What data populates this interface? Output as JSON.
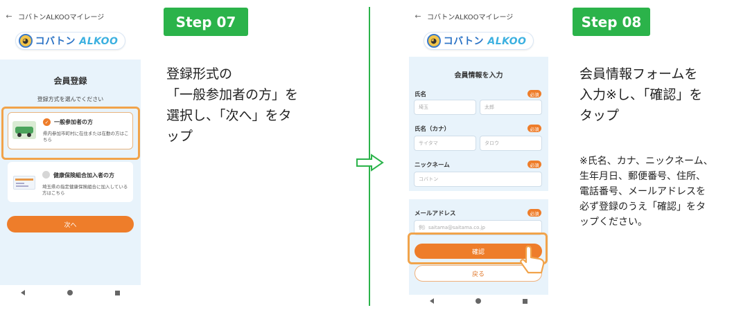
{
  "left_phone": {
    "back_icon": "←",
    "app_title": "コバトンALKOOマイレージ",
    "logo_text": "コバトン",
    "logo_text_en": "ALKOO",
    "page_title": "会員登録",
    "subtitle": "登録方式を選んでください",
    "option1": {
      "label": "一般参加者の方",
      "desc": "県内参加市町村に在住または在勤の方はこちら"
    },
    "option2": {
      "label": "健康保険組合加入者の方",
      "desc": "埼玉県の指定健康保険組合に加入している方はこちら"
    },
    "next_button": "次へ"
  },
  "step07": {
    "badge": "Step 07",
    "text": "登録形式の\n「一般参加者の方」を\n選択し、「次へ」をタ\nップ"
  },
  "right_phone": {
    "back_icon": "←",
    "app_title": "コバトンALKOOマイレージ",
    "logo_text": "コバトン",
    "logo_text_en": "ALKOO",
    "page_title": "会員情報を入力",
    "required": "必須",
    "name_label": "氏名",
    "name_last_placeholder": "埼玉",
    "name_first_placeholder": "太郎",
    "kana_label": "氏名（カナ）",
    "kana_last_placeholder": "サイタマ",
    "kana_first_placeholder": "タロウ",
    "nickname_label": "ニックネーム",
    "nickname_placeholder": "コバトン",
    "email_label": "メールアドレス",
    "email_placeholder": "例）saitama@saitama.co.jp",
    "confirm_button": "確認",
    "back_button": "戻る"
  },
  "step08": {
    "badge": "Step 08",
    "text": "会員情報フォームを\n入力※し、「確認」を\nタップ",
    "note": "※氏名、カナ、ニックネーム、\n生年月日、郵便番号、住所、\n電話番号、メールアドレスを\n必ず登録のうえ「確認」をタ\nップください。"
  },
  "colors": {
    "accent_green": "#2bb34a",
    "accent_orange": "#ee7d2a",
    "panel_blue": "#e8f3fb"
  }
}
